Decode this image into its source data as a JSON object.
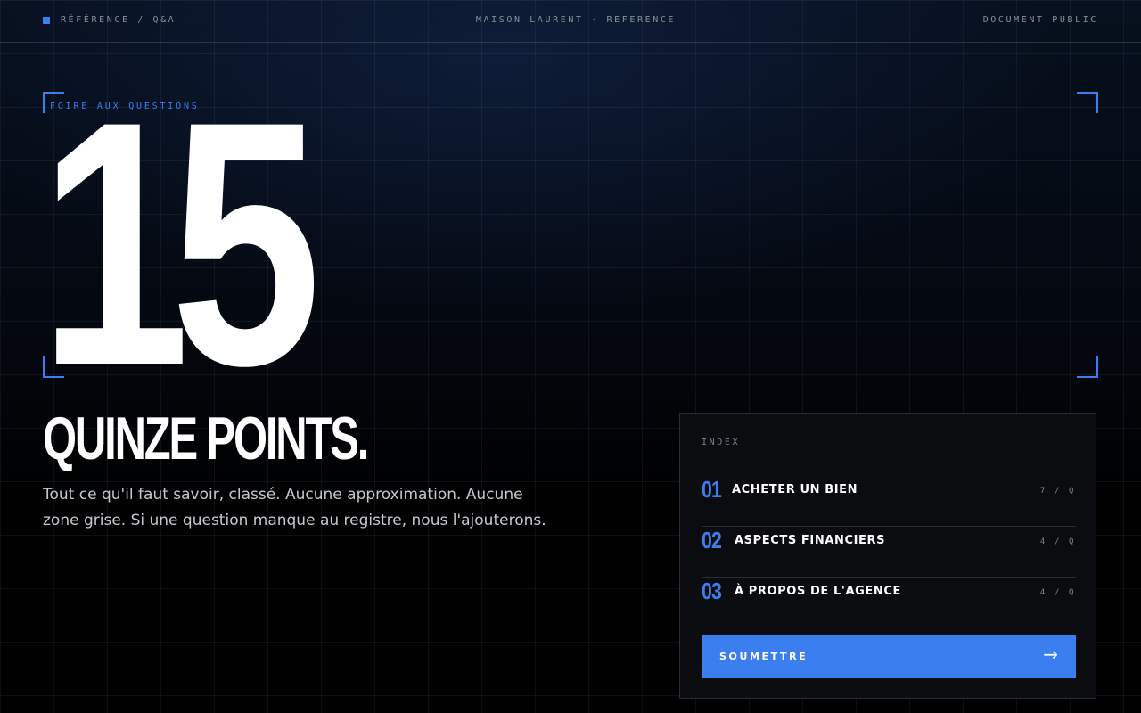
{
  "topbar": {
    "left_label": "RÉFÉRENCE / Q&A",
    "center_label": "MAISON LAURENT · REFERENCE",
    "right_label": "DOCUMENT PUBLIC"
  },
  "hero": {
    "eyebrow": "FOIRE AUX QUESTIONS",
    "big_number": "15",
    "headline": "QUINZE POINTS.",
    "intro": "Tout ce qu'il faut savoir, classé. Aucune approximation. Aucune zone grise. Si une question manque au registre, nous l'ajouterons."
  },
  "index": {
    "label": "INDEX",
    "items": [
      {
        "number": "01",
        "title": "ACHETER UN BIEN",
        "count": "7 / Q"
      },
      {
        "number": "02",
        "title": "ASPECTS FINANCIERS",
        "count": "4 / Q"
      },
      {
        "number": "03",
        "title": "À PROPOS DE L'AGENCE",
        "count": "4 / Q"
      }
    ],
    "submit_label": "SOUMETTRE",
    "submit_icon": "arrow-right-icon"
  },
  "colors": {
    "accent": "#3b7ef0",
    "background": "#000000",
    "panel": "#0b0c0f"
  }
}
